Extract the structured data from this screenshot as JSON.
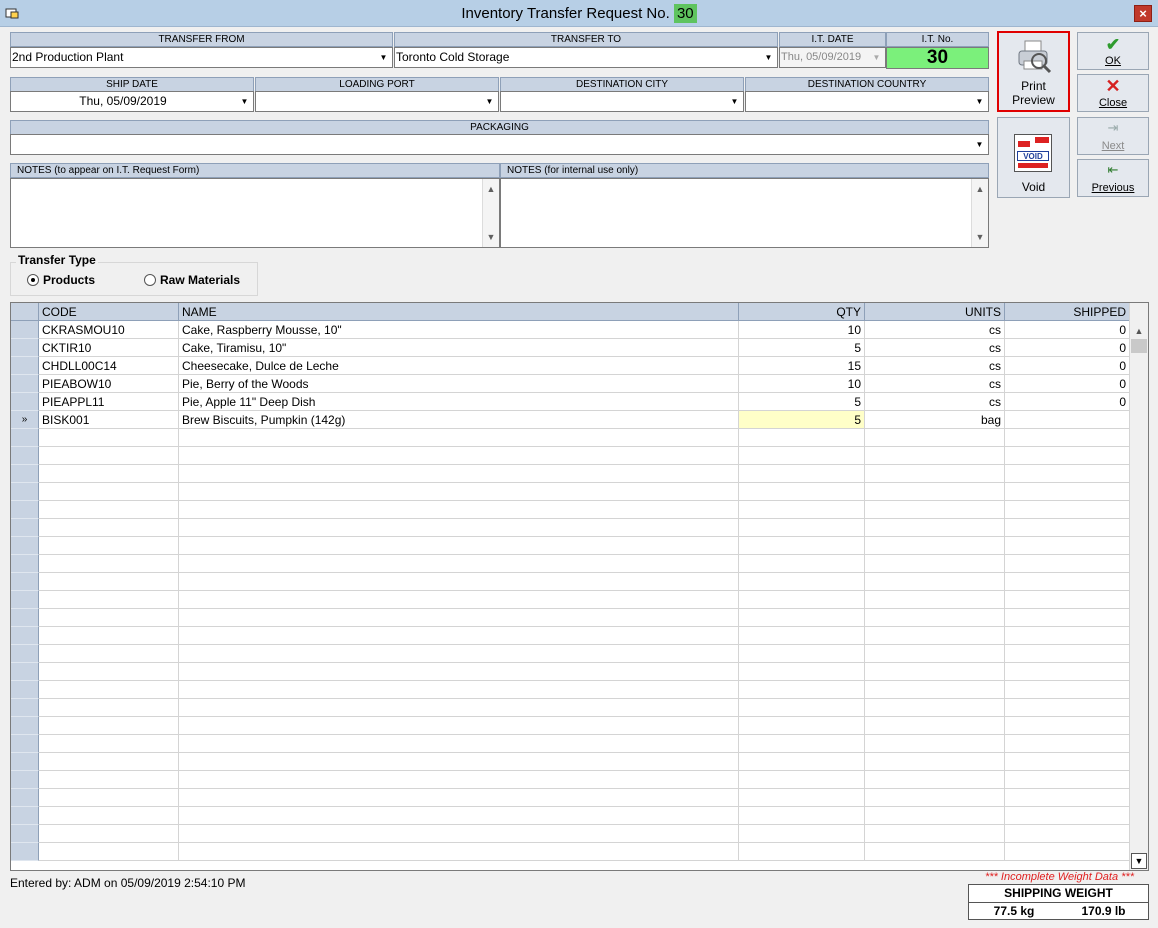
{
  "window": {
    "title": "Inventory Transfer Request No.",
    "title_number": "30",
    "close_glyph": "×"
  },
  "header": {
    "transfer_from_label": "TRANSFER FROM",
    "transfer_from_value": "2nd Production Plant",
    "transfer_to_label": "TRANSFER TO",
    "transfer_to_value": "Toronto Cold Storage",
    "it_date_label": "I.T. DATE",
    "it_date_value": "Thu, 05/09/2019",
    "it_no_label": "I.T. No.",
    "it_no_value": "30",
    "ship_date_label": "SHIP DATE",
    "ship_date_value": "Thu, 05/09/2019",
    "loading_port_label": "LOADING PORT",
    "loading_port_value": "",
    "destination_city_label": "DESTINATION CITY",
    "destination_city_value": "",
    "destination_country_label": "DESTINATION COUNTRY",
    "destination_country_value": "",
    "packaging_label": "PACKAGING",
    "packaging_value": "",
    "notes_form_label": "NOTES (to appear on I.T. Request Form)",
    "notes_form_value": "",
    "notes_internal_label": "NOTES (for internal use only)",
    "notes_internal_value": ""
  },
  "buttons": {
    "print_preview_line1": "Print",
    "print_preview_line2": "Preview",
    "ok": "OK",
    "close": "Close",
    "void": "Void",
    "void_icon_text": "VOID",
    "next": "Next",
    "previous": "Previous"
  },
  "transfer_type": {
    "title": "Transfer Type",
    "options": [
      "Products",
      "Raw Materials"
    ],
    "selected": "Products"
  },
  "grid": {
    "columns": [
      "CODE",
      "NAME",
      "QTY",
      "UNITS",
      "SHIPPED"
    ],
    "current_row_marker": "»",
    "rows": [
      {
        "code": "CKRASMOU10",
        "name": "Cake, Raspberry Mousse, 10\"",
        "qty": "10",
        "units": "cs",
        "shipped": "0"
      },
      {
        "code": "CKTIR10",
        "name": "Cake, Tiramisu, 10\"",
        "qty": "5",
        "units": "cs",
        "shipped": "0"
      },
      {
        "code": "CHDLL00C14",
        "name": "Cheesecake, Dulce de Leche",
        "qty": "15",
        "units": "cs",
        "shipped": "0"
      },
      {
        "code": "PIEABOW10",
        "name": "Pie, Berry of the Woods",
        "qty": "10",
        "units": "cs",
        "shipped": "0"
      },
      {
        "code": "PIEAPPL11",
        "name": "Pie, Apple 11\" Deep Dish",
        "qty": "5",
        "units": "cs",
        "shipped": "0"
      },
      {
        "code": "BISK001",
        "name": "Brew Biscuits, Pumpkin (142g)",
        "qty": "5",
        "units": "bag",
        "shipped": ""
      }
    ]
  },
  "footer": {
    "entered_by": "Entered by: ADM on 05/09/2019 2:54:10 PM",
    "warning": "*** Incomplete Weight Data ***",
    "shipping_weight_label": "SHIPPING WEIGHT",
    "weight_kg": "77.5 kg",
    "weight_lb": "170.9 lb"
  },
  "colors": {
    "it_no_bg": "#7bf07b",
    "title_number_bg": "#5fc45f",
    "header_bg": "#c8d3e2",
    "print_highlight": "#e00000",
    "warning": "#e02020",
    "active_cell": "#ffffc8"
  }
}
